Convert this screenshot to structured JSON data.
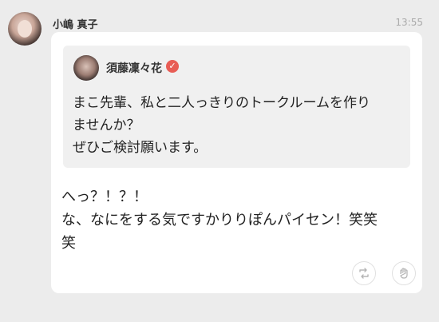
{
  "post": {
    "sender_name": "小嶋 真子",
    "timestamp": "13:55",
    "message": "へっ？！？！\nな、なにをする気ですかりりぽんパイセン！笑笑\n笑"
  },
  "quote": {
    "author_name": "須藤凜々花",
    "verified_icon": "checkmark-icon",
    "text": "まこ先輩、私と二人っきりのトークルームを作り\nませんか？\nぜひご検討願います。"
  },
  "actions": {
    "repost_icon": "repost-icon",
    "clap_icon": "clap-icon"
  },
  "colors": {
    "background": "#ececec",
    "bubble": "#ffffff",
    "quote_bg": "#f0f0f0",
    "verified_badge": "#e85d55",
    "timestamp": "#aaaaaa"
  }
}
